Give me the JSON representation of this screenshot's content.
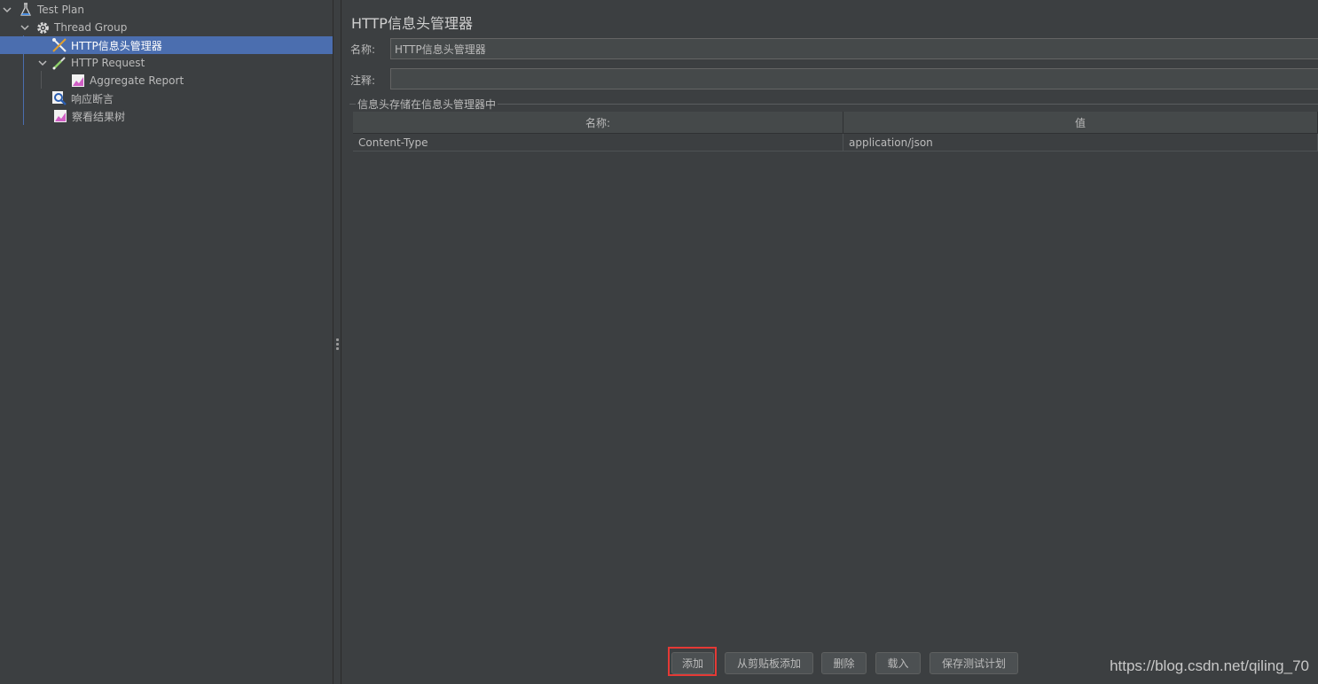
{
  "tree": {
    "items": [
      {
        "label": "Test Plan",
        "icon": "flask-icon"
      },
      {
        "label": "Thread Group",
        "icon": "gear-icon"
      },
      {
        "label": "HTTP信息头管理器",
        "icon": "wrench-icon"
      },
      {
        "label": "HTTP Request",
        "icon": "pipette-icon"
      },
      {
        "label": "Aggregate Report",
        "icon": "chart-icon"
      },
      {
        "label": "响应断言",
        "icon": "magnifier-icon"
      },
      {
        "label": "察看结果树",
        "icon": "chart-icon"
      }
    ]
  },
  "main": {
    "title": "HTTP信息头管理器",
    "name_label": "名称:",
    "name_value": "HTTP信息头管理器",
    "comment_label": "注释:",
    "comment_value": "",
    "group_title": "信息头存储在信息头管理器中",
    "table": {
      "columns": [
        "名称:",
        "值"
      ],
      "rows": [
        {
          "name": "Content-Type",
          "value": "application/json"
        }
      ]
    }
  },
  "buttons": {
    "add": "添加",
    "add_from_clipboard": "从剪贴板添加",
    "delete": "删除",
    "load": "载入",
    "save_plan": "保存测试计划"
  },
  "watermark": "https://blog.csdn.net/qiling_70",
  "colors": {
    "background": "#3c3f41",
    "selection": "#4b6eaf",
    "highlight": "#e53935"
  }
}
